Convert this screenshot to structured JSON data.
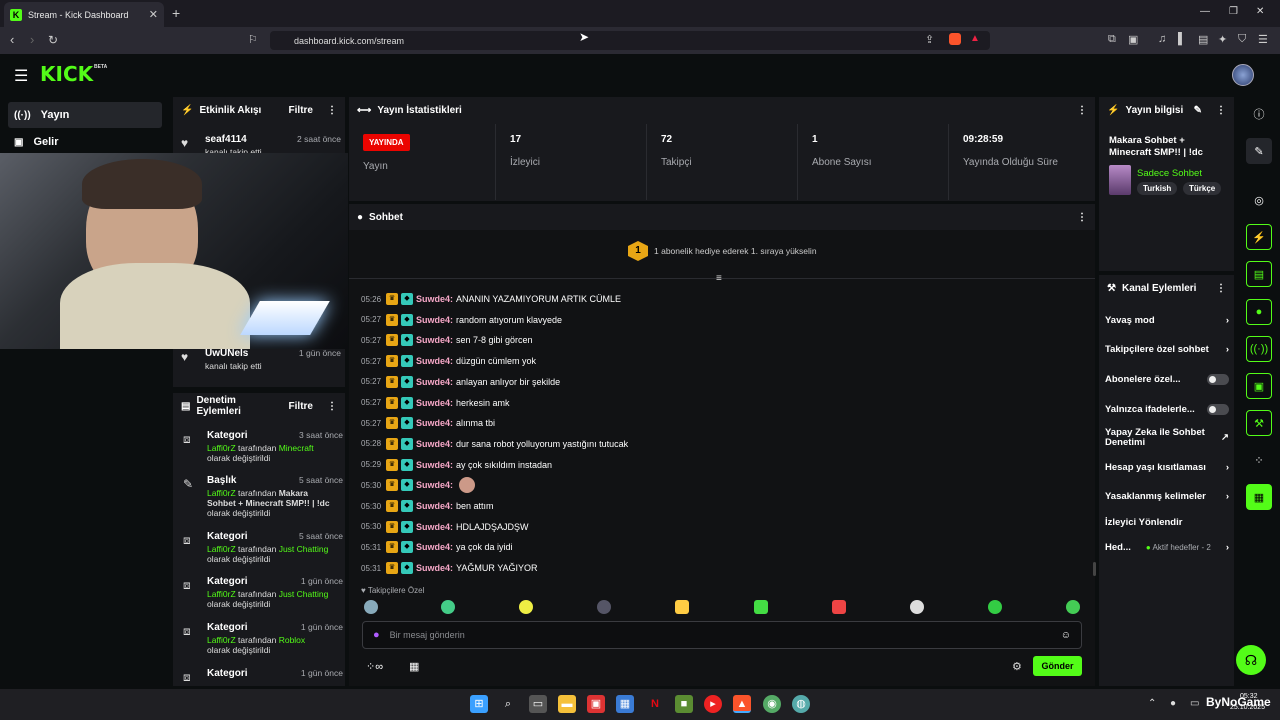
{
  "browser": {
    "tab_title": "Stream - Kick Dashboard",
    "url": "dashboard.kick.com/stream"
  },
  "header": {
    "logo": "KICK",
    "beta": "BETA"
  },
  "sidebar": {
    "items": [
      {
        "label": "Yayın",
        "icon": "broadcast-icon"
      },
      {
        "label": "Gelir",
        "icon": "wallet-icon"
      }
    ]
  },
  "activity": {
    "title": "Etkinlik Akışı",
    "filter": "Filtre",
    "items": [
      {
        "user": "seaf4114",
        "time": "2 saat önce",
        "action": "kanalı takip etti"
      },
      {
        "user": "UwUNels",
        "time": "1 gün önce",
        "action": "kanalı takip etti"
      }
    ]
  },
  "moderation": {
    "title": "Denetim Eylemleri",
    "filter": "Filtre",
    "items": [
      {
        "type": "Kategori",
        "time": "3 saat önce",
        "user": "Laffi0rZ",
        "by": "tarafından",
        "value": "Minecraft",
        "suffix": "olarak değiştirildi"
      },
      {
        "type": "Başlık",
        "time": "5 saat önce",
        "user": "Laffi0rZ",
        "by": "tarafından",
        "value": "Makara Sohbet + Minecraft SMP!! | !dc",
        "suffix": "olarak değiştirildi"
      },
      {
        "type": "Kategori",
        "time": "5 saat önce",
        "user": "Laffi0rZ",
        "by": "tarafından",
        "value": "Just Chatting",
        "suffix": "olarak değiştirildi"
      },
      {
        "type": "Kategori",
        "time": "1 gün önce",
        "user": "Laffi0rZ",
        "by": "tarafından",
        "value": "Just Chatting",
        "suffix": "olarak değiştirildi"
      },
      {
        "type": "Kategori",
        "time": "1 gün önce",
        "user": "Laffi0rZ",
        "by": "tarafından",
        "value": "Roblox",
        "suffix": "olarak değiştirildi"
      },
      {
        "type": "Kategori",
        "time": "1 gün önce"
      }
    ]
  },
  "stats": {
    "title": "Yayın İstatistikleri",
    "live_badge": "YAYINDA",
    "live_label": "Yayın",
    "viewers": "17",
    "viewers_label": "İzleyici",
    "followers": "72",
    "followers_label": "Takipçi",
    "subs": "1",
    "subs_label": "Abone Sayısı",
    "uptime": "09:28:59",
    "uptime_label": "Yayında Olduğu Süre"
  },
  "chat": {
    "title": "Sohbet",
    "gift_rank": "1",
    "gift_text": "1 abonelik hediye ederek 1. sıraya yükselin",
    "messages": [
      {
        "time": "05:26",
        "user": "Suwde4:",
        "text": "ANANIN YAZAMIYORUM ARTIK CÜMLE"
      },
      {
        "time": "05:27",
        "user": "Suwde4:",
        "text": "random atıyorum klavyede"
      },
      {
        "time": "05:27",
        "user": "Suwde4:",
        "text": "sen 7-8 gibi görcen"
      },
      {
        "time": "05:27",
        "user": "Suwde4:",
        "text": "düzgün cümlem yok"
      },
      {
        "time": "05:27",
        "user": "Suwde4:",
        "text": "anlayan anlıyor bir şekilde"
      },
      {
        "time": "05:27",
        "user": "Suwde4:",
        "text": "herkesin amk"
      },
      {
        "time": "05:27",
        "user": "Suwde4:",
        "text": "alınma tbi"
      },
      {
        "time": "05:28",
        "user": "Suwde4:",
        "text": "dur sana robot yolluyorum yastığını tutucak"
      },
      {
        "time": "05:29",
        "user": "Suwde4:",
        "text": "ay çok sıkıldım instadan"
      },
      {
        "time": "05:30",
        "user": "Suwde4:",
        "text": ""
      },
      {
        "time": "05:30",
        "user": "Suwde4:",
        "text": "ben attım"
      },
      {
        "time": "05:30",
        "user": "Suwde4:",
        "text": "HDLAJDŞAJDŞW"
      },
      {
        "time": "05:31",
        "user": "Suwde4:",
        "text": "ya çok da iyidi"
      },
      {
        "time": "05:31",
        "user": "Suwde4:",
        "text": "YAĞMUR YAĞIYOR"
      }
    ],
    "followers_only": "Takipçilere Özel",
    "input_placeholder": "Bir mesaj gönderin",
    "send": "Gönder"
  },
  "stream_info": {
    "title": "Yayın bilgisi",
    "stream_title": "Makara Sohbet + Minecraft SMP!! | !dc",
    "category": "Sadece Sohbet",
    "tags": [
      "Turkish",
      "Türkçe"
    ]
  },
  "channel_actions": {
    "title": "Kanal Eylemleri",
    "items": [
      {
        "label": "Yavaş mod",
        "control": "chevron"
      },
      {
        "label": "Takipçilere özel sohbet",
        "control": "chevron"
      },
      {
        "label": "Abonelere özel...",
        "control": "toggle"
      },
      {
        "label": "Yalnızca ifadelerle...",
        "control": "toggle"
      },
      {
        "label": "Yapay Zeka ile Sohbet Denetimi",
        "control": "external"
      },
      {
        "label": "Hesap yaşı kısıtlaması",
        "control": "chevron"
      },
      {
        "label": "Yasaklanmış kelimeler",
        "control": "chevron"
      },
      {
        "label": "İzleyici Yönlendir",
        "control": "none"
      },
      {
        "label": "Hed...",
        "control": "chevron",
        "extra": "Aktif hedefler - 2"
      }
    ]
  },
  "colors": {
    "accent": "#53fc18",
    "live": "#eb0400",
    "username": "#f7a8c8"
  },
  "tray": {
    "time": "05:32",
    "date": "25.10.2025",
    "watermark": "ByNoGame"
  }
}
